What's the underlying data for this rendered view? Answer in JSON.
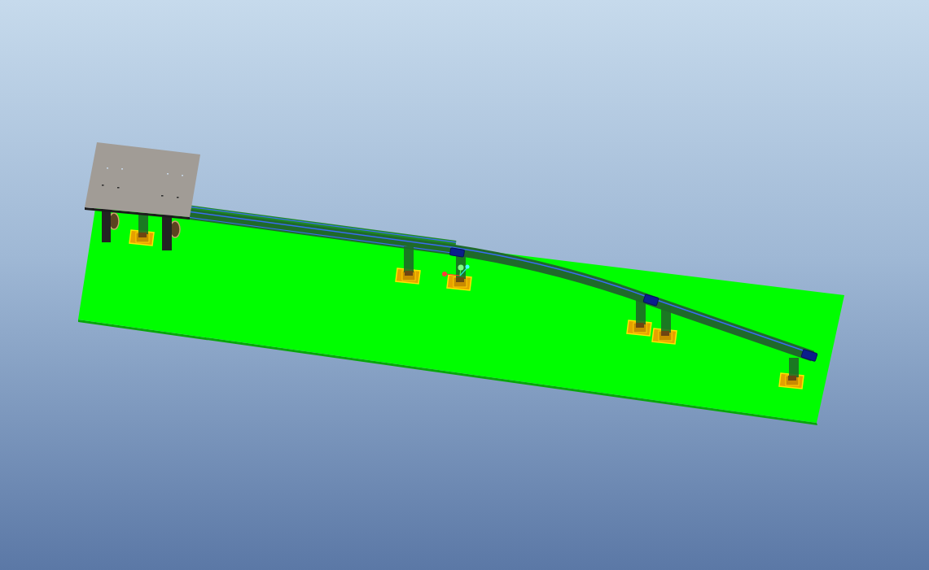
{
  "viewport": {
    "parts": [
      {
        "kind": "ground-plate"
      },
      {
        "kind": "rail"
      },
      {
        "kind": "support"
      },
      {
        "kind": "support"
      },
      {
        "kind": "support"
      },
      {
        "kind": "support"
      },
      {
        "kind": "support"
      },
      {
        "kind": "support"
      },
      {
        "kind": "connector"
      },
      {
        "kind": "connector"
      },
      {
        "kind": "connector"
      },
      {
        "kind": "leg"
      },
      {
        "kind": "leg"
      },
      {
        "kind": "top-plate"
      },
      {
        "kind": "axis-triad"
      }
    ]
  }
}
